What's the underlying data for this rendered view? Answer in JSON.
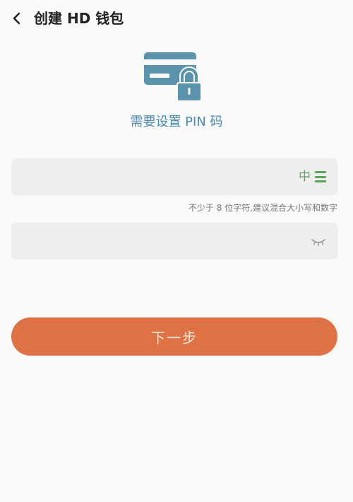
{
  "header": {
    "title": "创建 HD 钱包",
    "back_icon": "chevron-left-icon"
  },
  "hero": {
    "icon": "card-lock-icon",
    "subtitle": "需要设置 PIN 码"
  },
  "pin_field": {
    "value": "",
    "placeholder": "",
    "strength_label": "中",
    "strength_icon": "strength-bars-icon"
  },
  "hint": "不少于 8 位字符,建议混合大小写和数字",
  "confirm_field": {
    "value": "",
    "placeholder": "",
    "visibility_icon": "eye-closed-icon"
  },
  "next_button": {
    "label": "下一步"
  },
  "colors": {
    "accent": "#df7245",
    "subtitle": "#4a8aab",
    "strength": "#5aa55a",
    "field_bg": "#eeeeee"
  }
}
